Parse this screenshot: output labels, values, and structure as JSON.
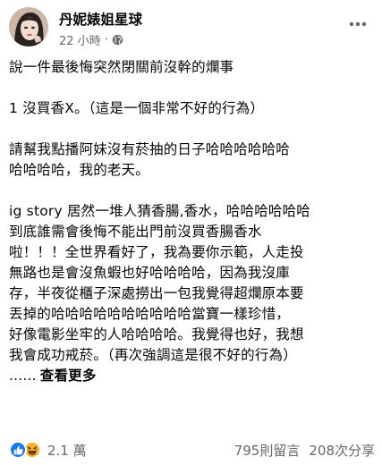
{
  "post": {
    "page_name": "丹妮婊姐星球",
    "timestamp": "22 小時",
    "separator": "·",
    "body_lines": [
      "說一件最後悔突然閉關前沒幹的爛事",
      "",
      "1 沒買香X。（這是一個非常不好的行為）",
      "",
      "請幫我點播阿妹沒有菸抽的日子哈哈哈哈哈哈",
      "哈哈哈哈，我的老天。",
      "",
      "ig story 居然一堆人猜香腸,香水，哈哈哈哈哈哈",
      "到底誰需會後悔不能出門前沒買香腸香水",
      "啦！！！全世界看好了，我為要你示範，人走投",
      "無路也是會沒魚蝦也好哈哈哈哈，因為我沒庫",
      "存，半夜從櫃子深處撈出一包我覺得超爛原本要",
      "丟掉的哈哈哈哈哈哈哈哈哈哈當寶一樣珍惜，",
      "好像電影坐牢的人哈哈哈哈。我覺得也好，我想",
      "我會成功戒菸。（再次強調這是很不好的行為）"
    ],
    "ellipsis": "......",
    "see_more": "查看更多"
  },
  "footer": {
    "reaction_count": "2.1 萬",
    "comments": "795則留言",
    "shares": "208次分享"
  },
  "icons": {
    "globe": "globe-icon",
    "more": "more-options-icon",
    "like": "like-reaction-icon",
    "haha": "haha-reaction-icon"
  },
  "colors": {
    "secondary_text": "#65676b",
    "like_blue": "#1877f2",
    "haha_yellow": "#f7b125"
  }
}
